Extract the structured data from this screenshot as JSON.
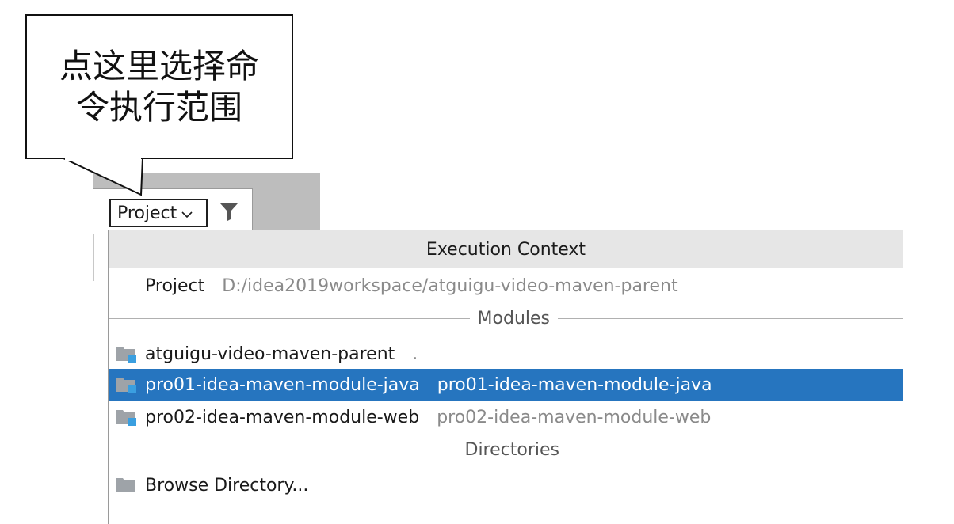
{
  "callout": {
    "line1": "点这里选择命",
    "line2": "令执行范围"
  },
  "toolbar": {
    "scope_label": "Project",
    "chevron_glyph": "∨",
    "filter_icon": "filter-icon"
  },
  "popup": {
    "title": "Execution Context",
    "project": {
      "label": "Project",
      "path": "D:/idea2019workspace/atguigu-video-maven-parent"
    },
    "modules_header": "Modules",
    "modules": [
      {
        "name": "atguigu-video-maven-parent",
        "hint": ".",
        "selected": false,
        "icon": "module-folder-icon"
      },
      {
        "name": "pro01-idea-maven-module-java",
        "hint": "pro01-idea-maven-module-java",
        "selected": true,
        "icon": "module-folder-icon"
      },
      {
        "name": "pro02-idea-maven-module-web",
        "hint": "pro02-idea-maven-module-web",
        "selected": false,
        "icon": "module-folder-icon"
      }
    ],
    "directories_header": "Directories",
    "browse_label": "Browse Directory...",
    "colors": {
      "selection": "#2675bf",
      "module_badge": "#3a9fe0",
      "folder": "#9ea3a8"
    }
  }
}
